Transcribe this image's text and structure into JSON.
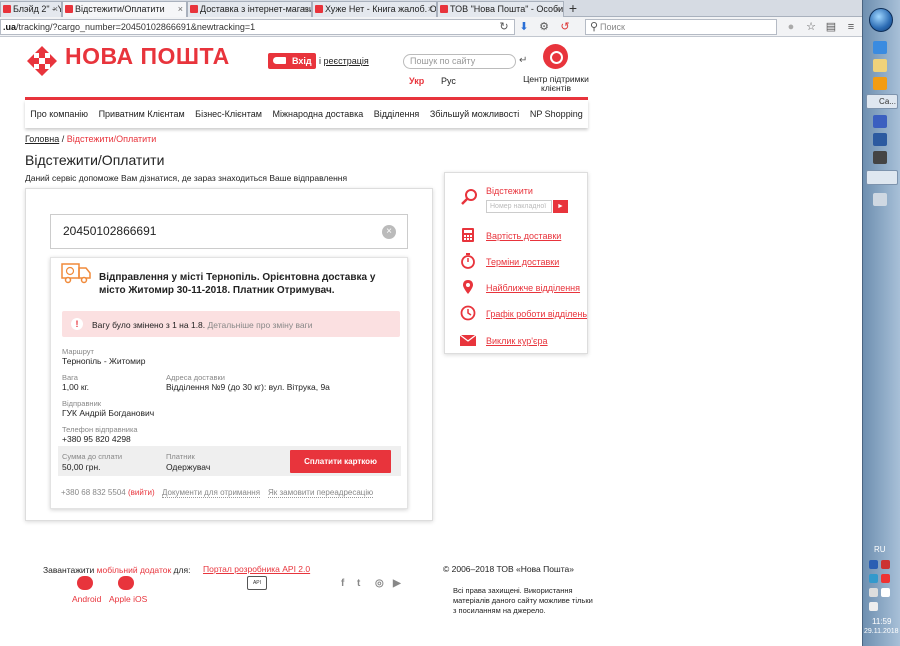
{
  "browser": {
    "tabs": [
      {
        "label": "Блэйд 2\" - You"
      },
      {
        "label": "Відстежити/Оплатити"
      },
      {
        "label": "Доставка з інтернет-магазин"
      },
      {
        "label": "Хуже Нет - Книга жалоб. Отз"
      },
      {
        "label": "ТОВ \"Нова Пошта\" - Особис"
      }
    ],
    "new_tab": "+",
    "url_host": ".ua",
    "url_path": "/tracking/?cargo_number=20450102866691&newtracking=1",
    "search_placeholder": "Поиск"
  },
  "taskbar": {
    "items": [
      "Са...",
      ""
    ],
    "lang": "RU",
    "time": "11:59",
    "date": "29.11.2018"
  },
  "header": {
    "logo_text": "НОВА ПОШТА",
    "login_label": "Вхід",
    "register_prefix": "і ",
    "register_label": "реєстрація",
    "search_placeholder": "Пошук по сайту",
    "search_go": "↵",
    "lang_ukr": "Укр",
    "lang_rus": "Рус",
    "support_label": "Центр підтримки клієнтів"
  },
  "nav": {
    "items": [
      "Про компанію",
      "Приватним Клієнтам",
      "Бізнес-Клієнтам",
      "Міжнародна доставка",
      "Відділення",
      "Збільшуй можливості",
      "NP Shopping"
    ]
  },
  "breadcrumb": {
    "home": "Головна",
    "separator": " / ",
    "current": "Відстежити/Оплатити"
  },
  "page": {
    "title": "Відстежити/Оплатити",
    "description": "Даний сервіс допоможе Вам дізнатися, де зараз знаходиться Ваше відправлення"
  },
  "tracking": {
    "number": "20450102866691",
    "clear": "×",
    "status": "Відправлення у місті Тернопіль. Орієнтовна доставка у місто Житомир 30-11-2018. Платник Отримувач.",
    "alert_icon": "!",
    "alert_text": "Вагу було змінено з 1 на 1.8.",
    "alert_link": "Детальніше про зміну ваги",
    "route_label": "Маршрут",
    "route_value": "Тернопіль - Житомир",
    "weight_label": "Вага",
    "weight_value": "1,00 кг.",
    "address_label": "Адреса доставки",
    "address_value": "Відділення №9 (до 30 кг): вул. Вітрука, 9а",
    "sender_label": "Відправник",
    "sender_value": "ГУК Андрій Богданович",
    "sender_phone_label": "Телефон відправника",
    "sender_phone_value": "+380 95 820 4298",
    "sum_label": "Сумма до сплати",
    "sum_value": "50,00 грн.",
    "payer_label": "Платник",
    "payer_value": "Одержувач",
    "pay_button": "Сплатити карткою",
    "recipient_phone": "+380 68 832 5504",
    "logout": "(вийти)",
    "docs_link": "Документи для отримання",
    "redirect_link": "Як замовити переадресацію"
  },
  "services": {
    "track_label": "Відстежити",
    "track_placeholder": "Номер накладної",
    "track_go": "►",
    "items": [
      "Вартість доставки",
      "Терміни доставки",
      "Найближче відділення",
      "Графік роботи відділень",
      "Виклик кур'єра"
    ]
  },
  "footer": {
    "download_prefix": "Завантажити ",
    "download_link": "мобільний додаток",
    "download_suffix": " для:",
    "android": "Android",
    "ios": "Apple iOS",
    "api_link": "Портал розробника API 2.0",
    "api_icon": "API",
    "social": [
      "f",
      "t",
      "◎",
      "▶"
    ],
    "copyright": "©  2006–2018 ТОВ «Нова Пошта»",
    "rights": "Всі права захищені. Використання матеріалів даного сайту можливе тільки з посиланням на джерело."
  },
  "colors": {
    "brand": "#e8343c",
    "alert_bg": "#fbe0e1"
  }
}
